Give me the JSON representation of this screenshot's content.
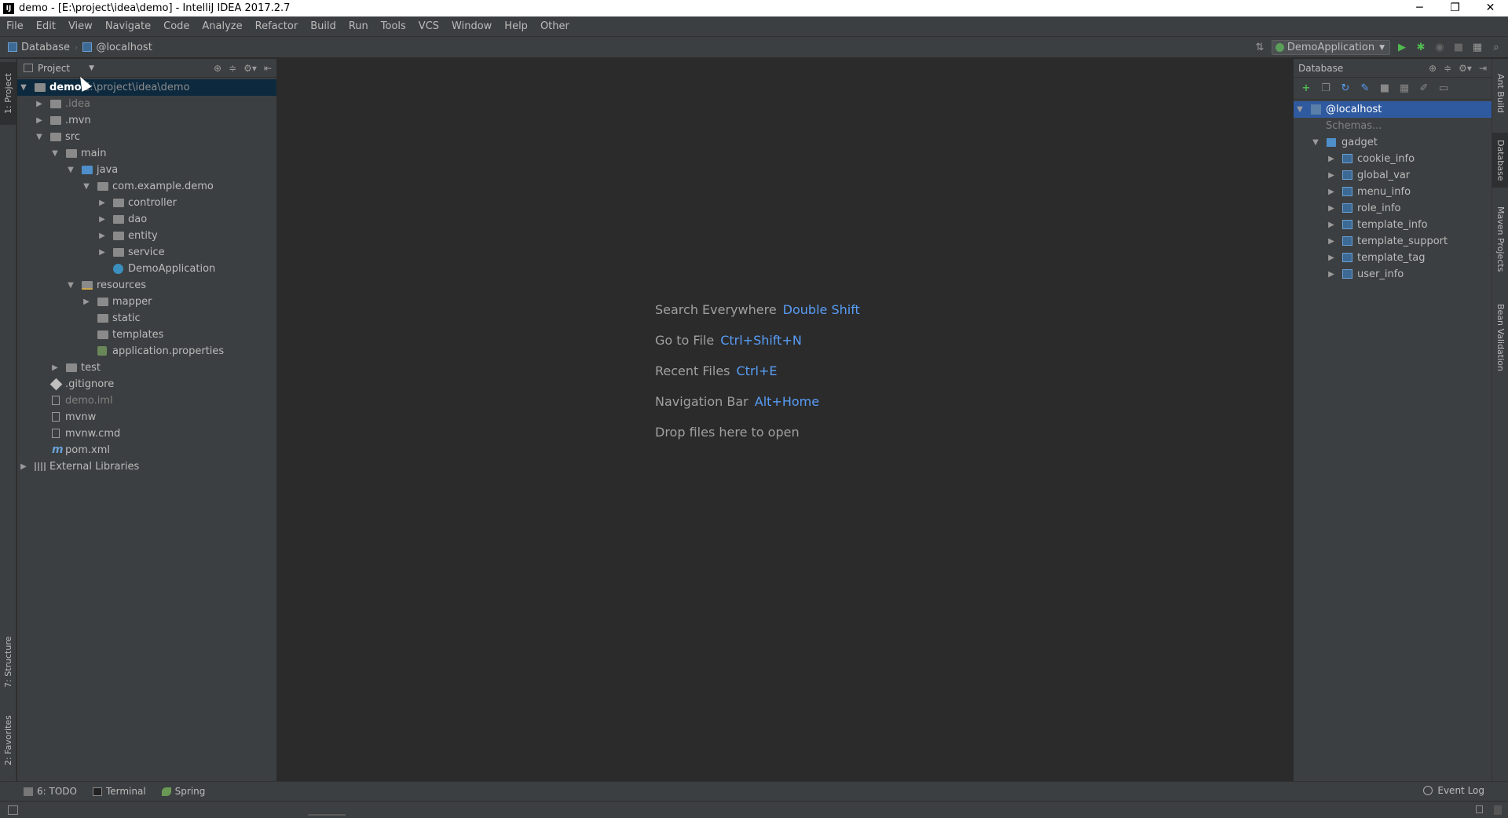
{
  "window": {
    "title": "demo - [E:\\project\\idea\\demo] - IntelliJ IDEA 2017.2.7",
    "controls": [
      "─",
      "❐",
      "✕"
    ]
  },
  "menubar": {
    "items": [
      "File",
      "Edit",
      "View",
      "Navigate",
      "Code",
      "Analyze",
      "Refactor",
      "Build",
      "Run",
      "Tools",
      "VCS",
      "Window",
      "Help",
      "Other"
    ]
  },
  "navbar": {
    "crumbs": [
      "Database",
      "@localhost"
    ],
    "run_config": "DemoApplication"
  },
  "left_stripe": {
    "project_tab": "1: Project",
    "structure_tab": "7: Structure",
    "favorites_tab": "2: Favorites"
  },
  "right_stripe": {
    "tabs": [
      "Ant Build",
      "Database",
      "Maven Projects",
      "Bean Validation"
    ]
  },
  "project_panel": {
    "title": "Project",
    "root_name": "demo",
    "root_path": "E:\\project\\idea\\demo",
    "nodes": [
      ".idea",
      ".mvn",
      "src",
      "main",
      "java",
      "com.example.demo",
      "controller",
      "dao",
      "entity",
      "service",
      "DemoApplication",
      "resources",
      "mapper",
      "static",
      "templates",
      "application.properties",
      "test",
      ".gitignore",
      "demo.iml",
      "mvnw",
      "mvnw.cmd",
      "pom.xml",
      "External Libraries"
    ]
  },
  "editor": {
    "hints": [
      {
        "label": "Search Everywhere",
        "key": "Double Shift"
      },
      {
        "label": "Go to File",
        "key": "Ctrl+Shift+N"
      },
      {
        "label": "Recent Files",
        "key": "Ctrl+E"
      },
      {
        "label": "Navigation Bar",
        "key": "Alt+Home"
      }
    ],
    "drop_text": "Drop files here to open"
  },
  "database_panel": {
    "title": "Database",
    "host": "@localhost",
    "schemas_label": "Schemas...",
    "schema": "gadget",
    "tables": [
      "cookie_info",
      "global_var",
      "menu_info",
      "role_info",
      "template_info",
      "template_support",
      "template_tag",
      "user_info"
    ]
  },
  "bottom_bar": {
    "todo": "6: TODO",
    "terminal": "Terminal",
    "spring": "Spring",
    "event_log": "Event Log"
  },
  "colors": {
    "accent_blue": "#589df6",
    "selection": "#0d293e",
    "db_selection": "#2f5aa0",
    "panel_bg": "#3c3f41",
    "editor_bg": "#2b2b2b"
  }
}
